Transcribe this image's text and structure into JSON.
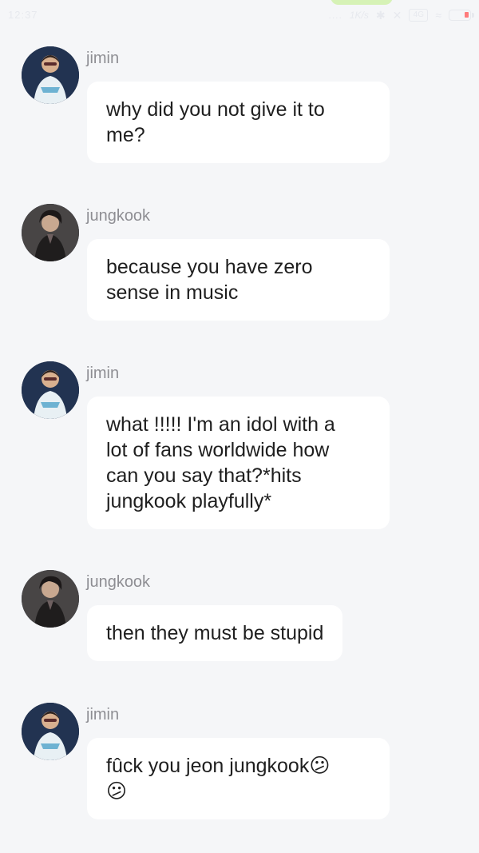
{
  "status_bar": {
    "time": "12:37",
    "signal": "....",
    "speed": "1K/s",
    "badge": "4G"
  },
  "messages": [
    {
      "sender": "jimin",
      "text": "why did you not give it to\nme?"
    },
    {
      "sender": "jungkook",
      "text": "because you have zero\nsense in music"
    },
    {
      "sender": "jimin",
      "text": "what !!!!! I'm an idol with a\nlot of fans worldwide how\ncan you say that?*hits\njungkook playfully*"
    },
    {
      "sender": "jungkook",
      "text": "then they must be stupid"
    },
    {
      "sender": "jimin",
      "text": "fûck you jeon jungkook😕\n😕"
    }
  ]
}
